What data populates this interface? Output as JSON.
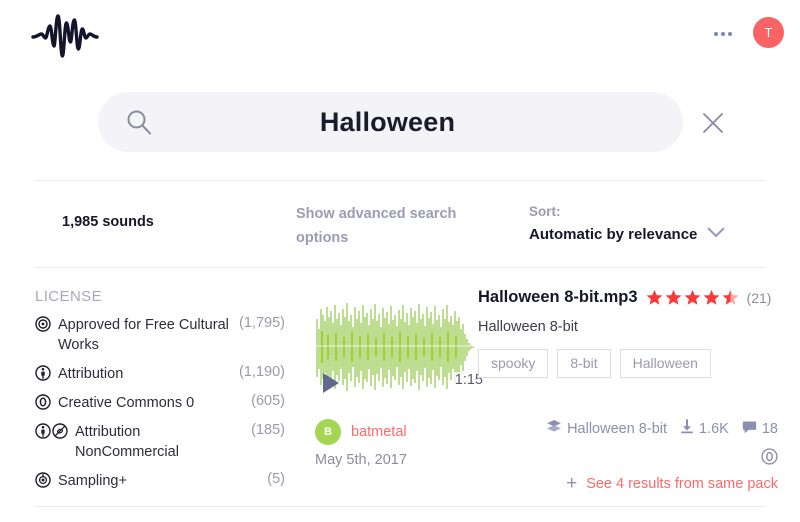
{
  "header": {
    "logo_icon": "waveform-logo",
    "more_icon": "ellipsis-icon",
    "avatar_initial": "T",
    "avatar_color": "#fa6363"
  },
  "search": {
    "icon": "search-icon",
    "value": "Halloween",
    "placeholder": "Search sounds...",
    "clear_icon": "close-icon"
  },
  "filters": {
    "sounds_count": "1,985 sounds",
    "advanced_search_label": "Show advanced search options",
    "sort_label": "Sort:",
    "sort_value": "Automatic by relevance",
    "sort_chevron_icon": "chevron-down-icon"
  },
  "sidebar": {
    "title": "LICENSE",
    "licenses": [
      {
        "icon": "cc-by-sa-icon",
        "label": "Approved for Free Cultural Works",
        "count": "(1,795)"
      },
      {
        "icon": "cc-by-icon",
        "label": "Attribution",
        "count": "(1,190)"
      },
      {
        "icon": "cc-zero-icon",
        "label": "Creative Commons 0",
        "count": "(605)"
      },
      {
        "icon": "cc-by-nc-icon",
        "label": "Attribution NonCommercial",
        "count": "(185)"
      },
      {
        "icon": "cc-sampling-icon",
        "label": "Sampling+",
        "count": "(5)"
      }
    ]
  },
  "result": {
    "waveform_color_top": "#7dc832",
    "waveform_color_mid": "#b5d425",
    "play_icon": "play-icon",
    "duration": "1:15",
    "uploader_initial": "B",
    "uploader_avatar_color": "#a3d653",
    "uploader": "batmetal",
    "date": "May 5th, 2017",
    "title": "Halloween 8-bit.mp3",
    "rating_stars": 4.5,
    "rating_count": "(21)",
    "star_color": "#f73b3b",
    "description": "Halloween 8-bit",
    "tags": [
      "spooky",
      "8-bit",
      "Halloween"
    ],
    "pack_icon": "layers-icon",
    "pack_name": "Halloween 8-bit",
    "download_icon": "download-icon",
    "downloads": "1.6K",
    "comment_icon": "comment-icon",
    "comments": "18",
    "license_icon": "cc-zero-icon",
    "same_pack_plus": "+",
    "same_pack_label": "See 4 results from same pack",
    "link_color": "#fc6a6a"
  }
}
